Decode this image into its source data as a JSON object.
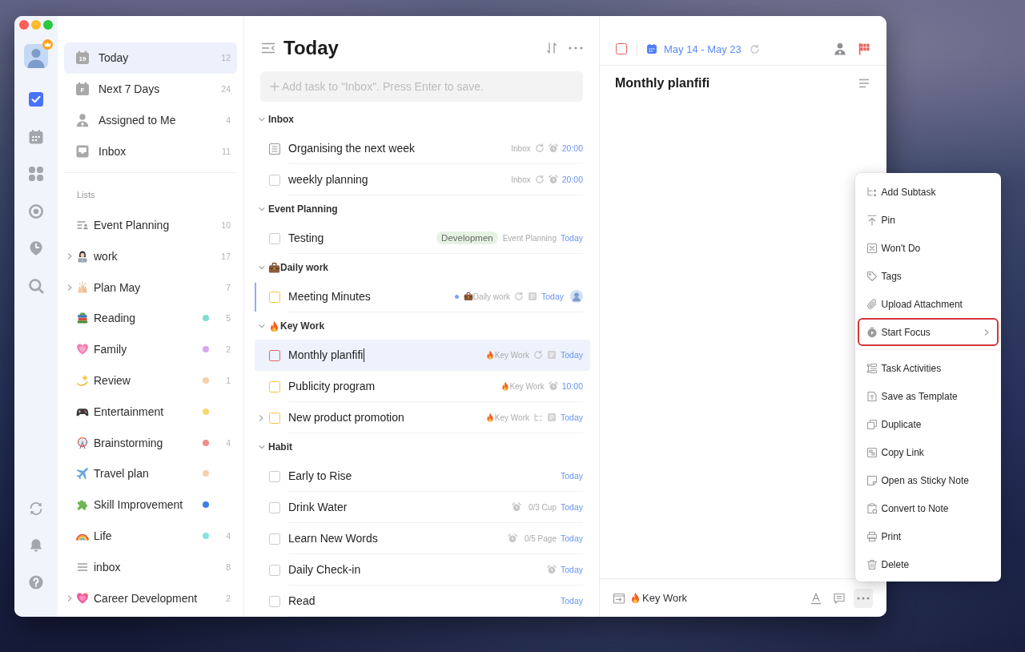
{
  "rail": {
    "nav": [
      {
        "selected": true
      },
      {
        "selected": false
      },
      {
        "selected": false
      },
      {
        "selected": false
      },
      {
        "selected": false
      },
      {
        "selected": false
      }
    ]
  },
  "sidebar": {
    "smart_lists": [
      {
        "label": "Today",
        "icon_label": "19",
        "count": "12",
        "selected": true
      },
      {
        "label": "Next 7 Days",
        "icon_label": "F",
        "count": "24",
        "selected": false
      },
      {
        "label": "Assigned to Me",
        "count": "4",
        "selected": false
      },
      {
        "label": "Inbox",
        "count": "11",
        "selected": false
      }
    ],
    "lists_heading": "Lists",
    "lists": [
      {
        "label": "Event Planning",
        "count": "10",
        "selected": false
      },
      {
        "label": "work",
        "count": "17",
        "expandable": true,
        "selected": false
      },
      {
        "label": "Plan May",
        "count": "7",
        "expandable": true,
        "selected": false
      },
      {
        "label": "Reading",
        "color": "#7fdcd3",
        "count": "5",
        "selected": false
      },
      {
        "label": "Family",
        "color": "#d9a6f3",
        "count": "2",
        "selected": false
      },
      {
        "label": "Review",
        "color": "#f8cfa6",
        "count": "1",
        "selected": false
      },
      {
        "label": "Entertainment",
        "color": "#f8d86e",
        "selected": false
      },
      {
        "label": "Brainstorming",
        "color": "#ef8e86",
        "count": "4",
        "selected": false
      },
      {
        "label": "Travel plan",
        "color": "#f8cfa6",
        "selected": false
      },
      {
        "label": "Skill Improvement",
        "color": "#3f7ee8",
        "selected": false
      },
      {
        "label": "Life",
        "color": "#84e3df",
        "count": "4",
        "selected": false
      },
      {
        "label": "inbox",
        "count": "8",
        "selected": false
      },
      {
        "label": "Career Development",
        "count": "2",
        "expandable": true,
        "selected": false
      }
    ]
  },
  "task_list": {
    "title": "Today",
    "add_task": {
      "placeholder": "Add task to \"Inbox\". Press Enter to save."
    },
    "sections": [
      {
        "name": "Inbox",
        "expanded": true,
        "tasks": [
          {
            "title": "Organising the next week",
            "kind": "note",
            "selected": false,
            "list": {
              "name": "Inbox"
            },
            "repeat": true,
            "reminder": true,
            "due": "20:00"
          },
          {
            "title": "weekly planning",
            "kind": "checkbox",
            "color": "#c9c9c9",
            "selected": false,
            "list": {
              "name": "Inbox"
            },
            "repeat": true,
            "reminder": true,
            "due": "20:00"
          }
        ]
      },
      {
        "name": "Event Planning",
        "expanded": true,
        "tasks": [
          {
            "title": "Testing",
            "kind": "checkbox",
            "color": "#c9c9c9",
            "selected": false,
            "tag": "Developmen",
            "list": {
              "name": "Event Planning"
            },
            "due": "Today"
          }
        ]
      },
      {
        "name": "Daily work",
        "expanded": true,
        "tasks": [
          {
            "title": "Meeting Minutes",
            "kind": "checkbox",
            "color": "#f5c443",
            "selected": false,
            "marked": true,
            "list": {
              "name": "Daily work",
              "color": "#7fa2f6"
            },
            "repeat": true,
            "has_notes": true,
            "due": "Today",
            "assigned": true
          }
        ]
      },
      {
        "name": "Key Work",
        "expanded": true,
        "tasks": [
          {
            "title": "Monthly planfifi",
            "kind": "checkbox",
            "color": "#e5625b",
            "selected": true,
            "list": {
              "name": "Key Work"
            },
            "repeat": true,
            "has_notes": true,
            "due": "Today"
          },
          {
            "title": "Publicity program",
            "kind": "checkbox",
            "color": "#f5c443",
            "selected": false,
            "list": {
              "name": "Key Work"
            },
            "reminder": true,
            "due": "10:00"
          },
          {
            "title": "New product promotion",
            "kind": "checkbox",
            "color": "#f5c443",
            "selected": false,
            "has_subtasks": true,
            "list": {
              "name": "Key Work"
            },
            "has_notes": true,
            "due": "Today"
          }
        ]
      },
      {
        "name": "Habit",
        "expanded": true,
        "tasks": [
          {
            "title": "Early to Rise",
            "kind": "checkbox",
            "color": "#c9c9c9",
            "selected": false,
            "due": "Today"
          },
          {
            "title": "Drink Water",
            "kind": "checkbox",
            "color": "#c9c9c9",
            "selected": false,
            "reminder": true,
            "progress": "0/3 Cup",
            "due": "Today"
          },
          {
            "title": "Learn New Words",
            "kind": "checkbox",
            "color": "#c9c9c9",
            "selected": false,
            "reminder": true,
            "progress": "0/5 Page",
            "due": "Today"
          },
          {
            "title": "Daily Check-in",
            "kind": "checkbox",
            "color": "#c9c9c9",
            "selected": false,
            "reminder": true,
            "due": "Today"
          },
          {
            "title": "Read",
            "kind": "checkbox",
            "color": "#c9c9c9",
            "selected": false,
            "due": "Today"
          }
        ]
      }
    ]
  },
  "detail": {
    "color": "#e5625b",
    "date": "May 14 - May 23",
    "repeat": true,
    "title": "Monthly planfifi",
    "list": "Key Work"
  },
  "context_menu": {
    "open": true,
    "groups": [
      [
        {
          "label": "Add Subtask",
          "highlighted": false
        },
        {
          "label": "Pin",
          "highlighted": false
        },
        {
          "label": "Won't Do",
          "highlighted": false
        },
        {
          "label": "Tags",
          "highlighted": false
        },
        {
          "label": "Upload Attachment",
          "highlighted": false
        },
        {
          "label": "Start Focus",
          "highlighted": true,
          "submenu": true
        }
      ],
      [
        {
          "label": "Task Activities",
          "highlighted": false
        },
        {
          "label": "Save as Template",
          "highlighted": false
        },
        {
          "label": "Duplicate",
          "highlighted": false
        },
        {
          "label": "Copy Link",
          "highlighted": false
        },
        {
          "label": "Open as Sticky Note",
          "highlighted": false
        },
        {
          "label": "Convert to Note",
          "highlighted": false
        },
        {
          "label": "Print",
          "highlighted": false
        },
        {
          "label": "Delete",
          "highlighted": false
        }
      ]
    ]
  }
}
